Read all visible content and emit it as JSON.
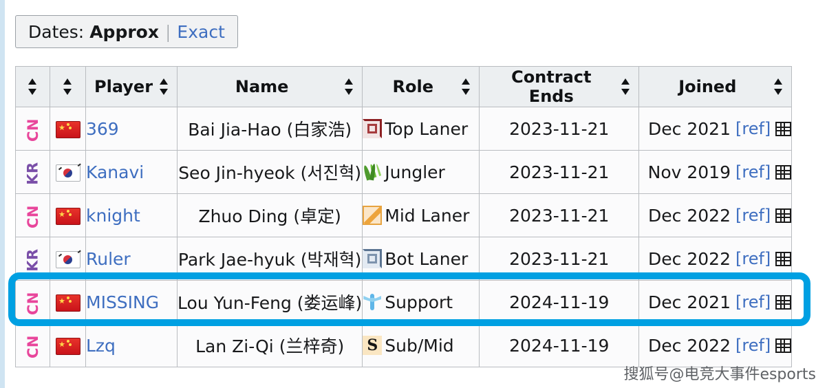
{
  "dates_toggle": {
    "label": "Dates:",
    "approx": "Approx",
    "separator": "|",
    "exact": "Exact"
  },
  "table": {
    "headers": {
      "country_code": "",
      "flag": "",
      "player": "Player",
      "name": "Name",
      "role": "Role",
      "contract_ends": "Contract Ends",
      "joined": "Joined"
    },
    "rows": [
      {
        "country_code": "CN",
        "flag": "flag-cn",
        "player": "369",
        "name": "Bai Jia-Hao (白家浩)",
        "role_icon": "top-laner-icon",
        "role": "Top Laner",
        "contract_ends": "2023-11-21",
        "joined": "Dec 2021",
        "ref": "[ref]",
        "highlighted": false
      },
      {
        "country_code": "KR",
        "flag": "flag-kr",
        "player": "Kanavi",
        "name": "Seo Jin-hyeok (서진혁)",
        "role_icon": "jungler-icon",
        "role": "Jungler",
        "contract_ends": "2023-11-21",
        "joined": "Nov 2019",
        "ref": "[ref]",
        "highlighted": false
      },
      {
        "country_code": "CN",
        "flag": "flag-cn",
        "player": "knight",
        "name": "Zhuo Ding (卓定)",
        "role_icon": "mid-laner-icon",
        "role": "Mid Laner",
        "contract_ends": "2023-11-21",
        "joined": "Dec 2022",
        "ref": "[ref]",
        "highlighted": false
      },
      {
        "country_code": "KR",
        "flag": "flag-kr",
        "player": "Ruler",
        "name": "Park Jae-hyuk (박재혁)",
        "role_icon": "bot-laner-icon",
        "role": "Bot Laner",
        "contract_ends": "2023-11-21",
        "joined": "Dec 2022",
        "ref": "[ref]",
        "highlighted": false
      },
      {
        "country_code": "CN",
        "flag": "flag-cn",
        "player": "MISSING",
        "name": "Lou Yun-Feng (娄运峰)",
        "role_icon": "support-icon",
        "role": "Support",
        "contract_ends": "2024-11-19",
        "joined": "Dec 2021",
        "ref": "[ref]",
        "highlighted": true
      },
      {
        "country_code": "CN",
        "flag": "flag-cn",
        "player": "Lzq",
        "name": "Lan Zi-Qi (兰梓奇)",
        "role_icon": "sub-mid-icon",
        "role": "Sub/Mid",
        "contract_ends": "2024-11-19",
        "joined": "Dec 2022",
        "ref": "[ref]",
        "highlighted": false
      }
    ]
  },
  "sub_icon_glyph": "S",
  "watermark": "搜狐号@电竞大事件esports",
  "colors": {
    "link_blue": "#3e6ec0",
    "highlight_blue": "#00a0e2",
    "cn_pink": "#e8469b",
    "kr_purple": "#7a4fa8",
    "header_bg": "#eceff1",
    "row_bg": "#fbfbfc",
    "border": "#b9bcc0"
  }
}
